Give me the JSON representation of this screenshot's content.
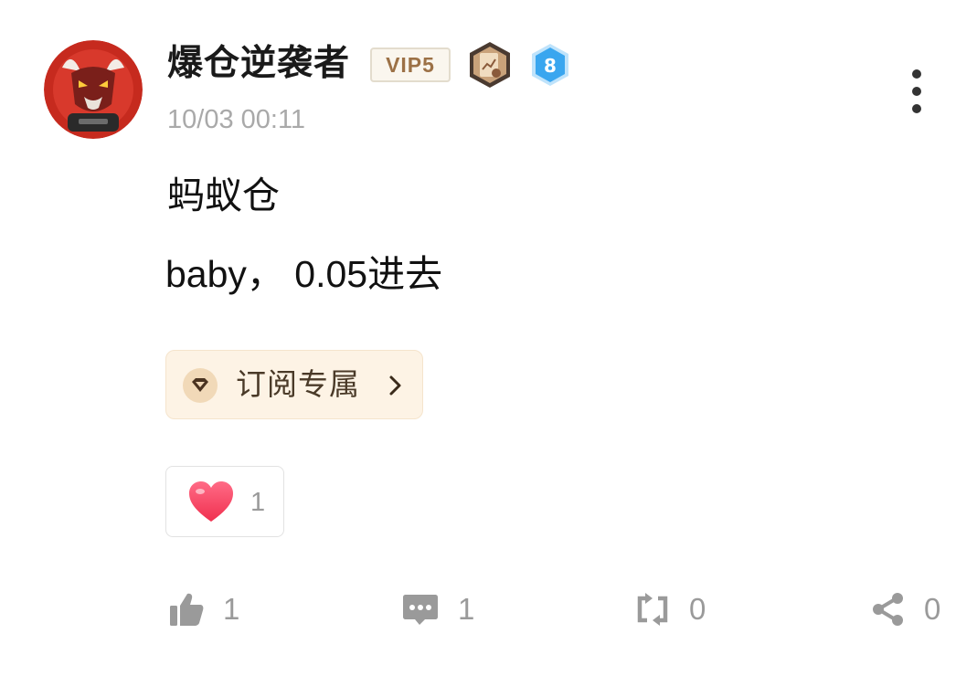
{
  "post": {
    "author": {
      "name": "爆仓逆袭者",
      "vip_label": "VIP5",
      "level": "8"
    },
    "timestamp": "10/03 00:11",
    "content": {
      "line1": "蚂蚁仓",
      "line2": "baby， 0.05进去"
    },
    "subscribe_label": "订阅专属",
    "reaction": {
      "count": "1"
    }
  },
  "actions": {
    "like_count": "1",
    "comment_count": "1",
    "repost_count": "0",
    "share_count": "0"
  },
  "icons": {
    "more": "more-vertical-icon",
    "subscribe": "diamond-icon",
    "chevron": "chevron-right-icon",
    "heart": "heart-icon",
    "like": "thumbs-up-icon",
    "comment": "comment-icon",
    "repost": "repost-icon",
    "share": "share-icon"
  },
  "colors": {
    "vip_text": "#9c7146",
    "level_badge": "#3aa6ef",
    "heart": "#ff4a6e",
    "action_icon": "#9a9a9a",
    "subscribe_bg": "#fdf3e5"
  }
}
